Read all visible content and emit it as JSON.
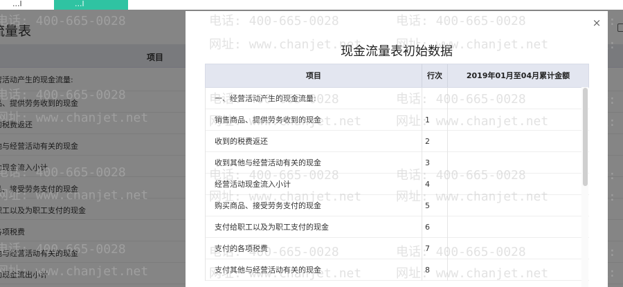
{
  "background": {
    "tabs": [
      {
        "label": "...l"
      },
      {
        "label": "...l"
      }
    ],
    "page_title": "流量表",
    "table_header": "项目",
    "rows": [
      "营活动产生的现金流量:",
      "品、提供劳务收到的现金",
      "的税费返还",
      "他与经营活动有关的现金",
      "动现金流入小计",
      "品、接受劳务支付的现金",
      "职工以及为职工支付的现金",
      "各项税费",
      "他与经营活动有关的现金",
      "动现金流出小计"
    ]
  },
  "watermark": {
    "phone": "电话: 400-665-0028",
    "site": "网址: www.chanjet.net"
  },
  "modal": {
    "close_glyph": "×",
    "title": "现金流量表初始数据",
    "columns": {
      "item": "项目",
      "line": "行次",
      "amount": "2019年01月至04月累计金额"
    },
    "rows": [
      {
        "item": "一、经营活动产生的现金流量:",
        "line": ""
      },
      {
        "item": "销售商品、提供劳务收到的现金",
        "line": "1"
      },
      {
        "item": "收到的税费返还",
        "line": "2"
      },
      {
        "item": "收到其他与经营活动有关的现金",
        "line": "3"
      },
      {
        "item": "经营活动现金流入小计",
        "line": "4"
      },
      {
        "item": "购买商品、接受劳务支付的现金",
        "line": "5"
      },
      {
        "item": "支付给职工以及为职工支付的现金",
        "line": "6"
      },
      {
        "item": "支付的各项税费",
        "line": "7"
      },
      {
        "item": "支付其他与经营活动有关的现金",
        "line": "8"
      }
    ]
  }
}
